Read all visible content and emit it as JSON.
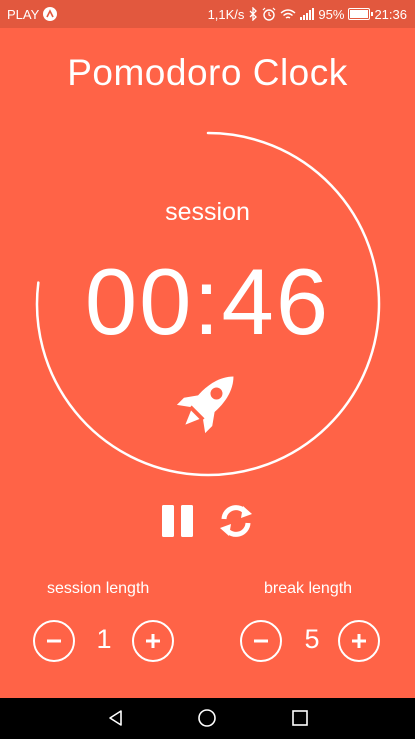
{
  "status_bar": {
    "carrier": "PLAY",
    "net_speed": "1,1K/s",
    "battery": "95%",
    "battery_level": 0.95,
    "time": "21:36"
  },
  "app": {
    "title": "Pomodoro Clock"
  },
  "timer": {
    "mode": "session",
    "time": "00:46",
    "progress": 0.77,
    "icon": "rocket-icon"
  },
  "controls": {
    "pause_icon": "pause-icon",
    "reset_icon": "refresh-icon"
  },
  "settings": {
    "session": {
      "label": "session length",
      "value": "1"
    },
    "break": {
      "label": "break length",
      "value": "5"
    }
  },
  "nav": {
    "back_icon": "back-triangle-icon",
    "home_icon": "home-circle-icon",
    "recents_icon": "recents-square-icon"
  },
  "colors": {
    "background": "#FF6347",
    "status_bar": "#E2583E",
    "foreground": "#FFFFFF"
  }
}
